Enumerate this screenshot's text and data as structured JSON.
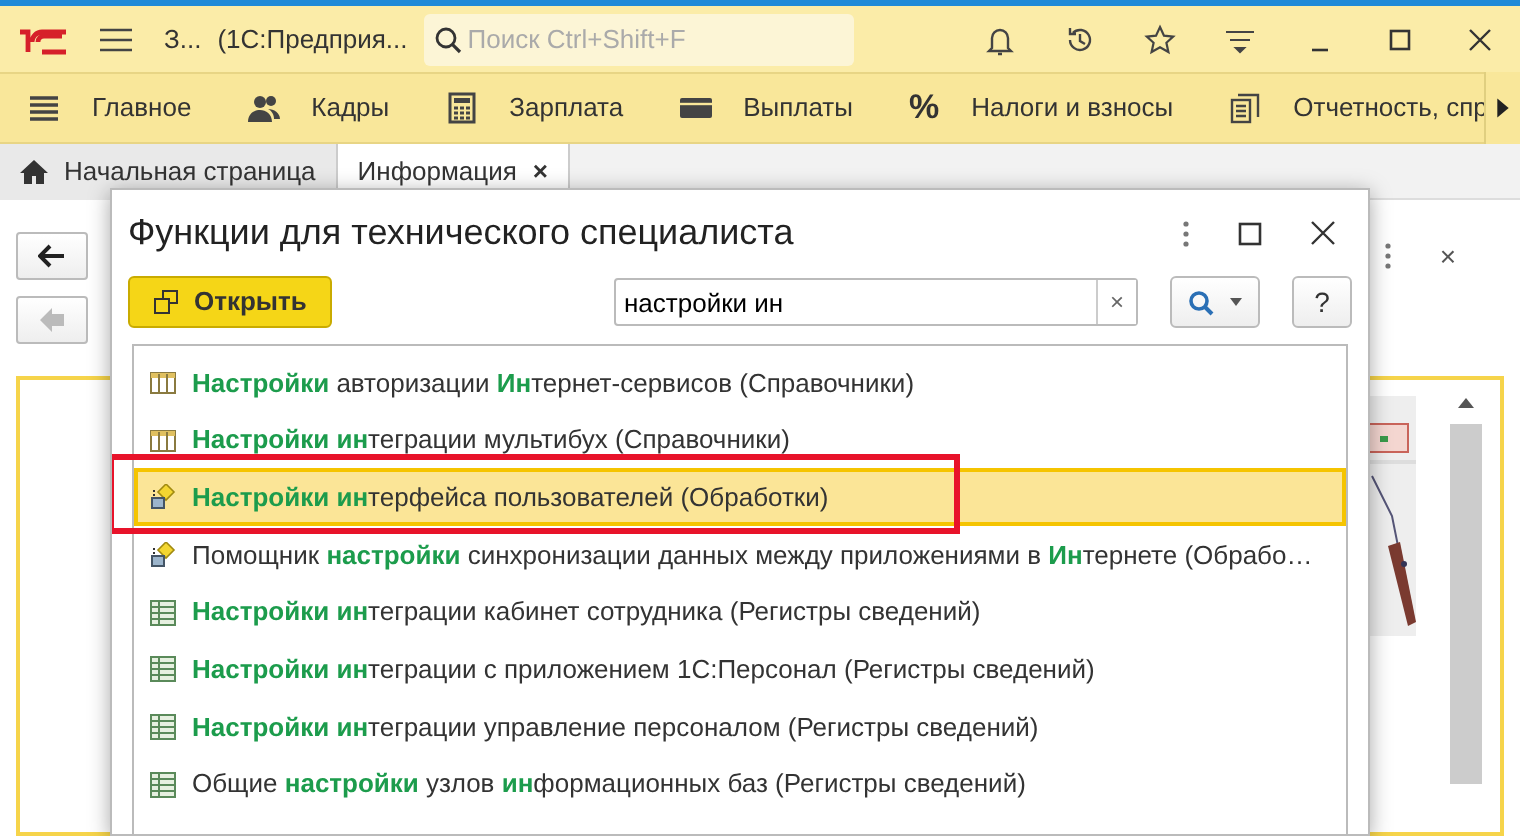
{
  "app_bar": {
    "title_short": "З...",
    "title": "(1С:Предприя...",
    "search": {
      "placeholder": "Поиск Ctrl+Shift+F"
    }
  },
  "sections": [
    {
      "kind": "menu",
      "label": "Главное"
    },
    {
      "kind": "people",
      "label": "Кадры"
    },
    {
      "kind": "calculator",
      "label": "Зарплата"
    },
    {
      "kind": "wallet",
      "label": "Выплаты"
    },
    {
      "kind": "glyph",
      "glyph": "%",
      "label": "Налоги и взносы"
    },
    {
      "kind": "documents",
      "label": "Отчетность, спр"
    }
  ],
  "tabs": [
    {
      "kind": "home",
      "label": "Начальная страница",
      "selected": false
    },
    {
      "kind": "closable",
      "label": "Информация",
      "close": "×",
      "selected": true
    }
  ],
  "dialog": {
    "title": "Функции для технического специалиста",
    "open_button": "Открыть",
    "search": {
      "value": "настройки ин",
      "clear": "×"
    },
    "help_button": "?",
    "items": [
      {
        "kind": "catalog",
        "text": "**Настройки** авторизации **Ин**тернет-сервисов (Справочники)",
        "selected": false,
        "annotated": false
      },
      {
        "kind": "catalog",
        "text": "**Настройки ин**теграции мультибух (Справочники)",
        "selected": false,
        "annotated": false
      },
      {
        "kind": "processing",
        "text": "**Настройки ин**терфейса пользователей (Обработки)",
        "selected": true,
        "annotated": true
      },
      {
        "kind": "processing",
        "text": "Помощник **настройки** синхронизации данных между приложениями в **Ин**тернете (Обрабо…",
        "selected": false,
        "annotated": false
      },
      {
        "kind": "register",
        "text": "**Настройки ин**теграции кабинет сотрудника (Регистры сведений)",
        "selected": false,
        "annotated": false
      },
      {
        "kind": "register",
        "text": "**Настройки ин**теграции с приложением 1С:Персонал (Регистры сведений)",
        "selected": false,
        "annotated": false
      },
      {
        "kind": "register",
        "text": "**Настройки ин**теграции управление персоналом (Регистры сведений)",
        "selected": false,
        "annotated": false
      },
      {
        "kind": "register",
        "text": "Общие **настройки** узлов **ин**формационных баз (Регистры сведений)",
        "selected": false,
        "annotated": false
      }
    ]
  },
  "background_form": {
    "close": "×"
  }
}
